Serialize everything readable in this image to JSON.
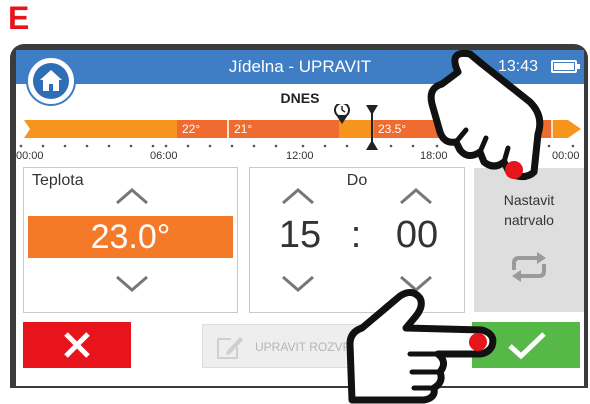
{
  "corner_letter": "E",
  "header": {
    "title": "Jídelna - UPRAVIT",
    "time": "13:43",
    "day_label": "DNES"
  },
  "timeline": {
    "segments": [
      {
        "label": "22°"
      },
      {
        "label": "21°"
      },
      {
        "label": "23.5°"
      }
    ],
    "tick_labels": [
      "00:00",
      "06:00",
      "12:00",
      "18:00",
      "00:00"
    ],
    "colors": {
      "light": "#f7941d",
      "dark": "#ef6b2f"
    }
  },
  "temperature": {
    "label": "Teplota",
    "value": "23.0°"
  },
  "until": {
    "label": "Do",
    "hours": "15",
    "separator": ":",
    "minutes": "00"
  },
  "permanent": {
    "line1": "Nastavit",
    "line2": "natrvalo"
  },
  "buttons": {
    "edit_label": "UPRAVIT ROZVRH"
  },
  "icons": {
    "home": "home-icon",
    "battery": "battery-icon",
    "clock": "clock-icon",
    "cancel": "x-icon",
    "confirm": "check-icon",
    "repeat": "repeat-icon",
    "pencil": "pencil-icon",
    "hand": "hand-pointer-icon"
  },
  "colors": {
    "topbar": "#3f7ec4",
    "temp_value_bg": "#f47a2a",
    "cancel": "#e8141c",
    "confirm": "#56b947",
    "touch_dot": "#e8141c"
  }
}
